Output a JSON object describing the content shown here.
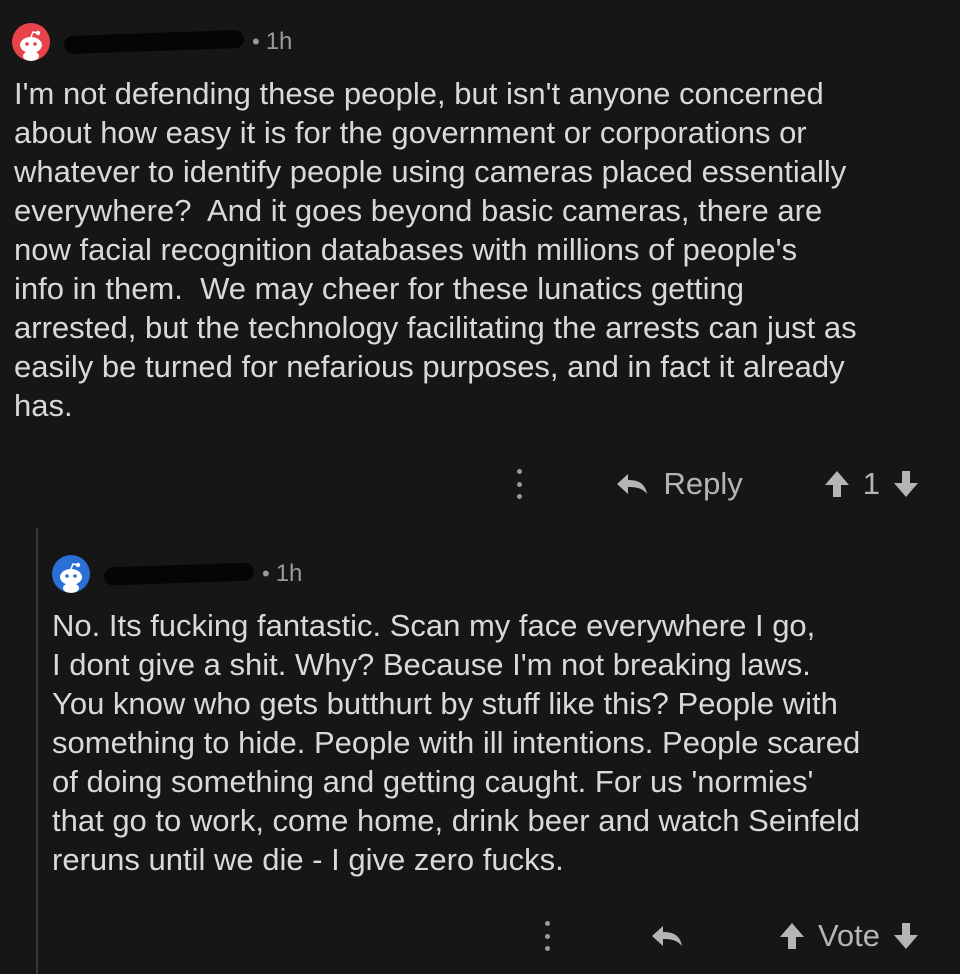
{
  "comments": [
    {
      "avatar_icon": "snoo-avatar-icon",
      "avatar_color": "#e8424a",
      "separator": "•",
      "time": "1h",
      "body": "I'm not defending these people, but isn't anyone concerned\nabout how easy it is for the government or corporations or\nwhatever to identify people using cameras placed essentially\neverywhere?  And it goes beyond basic cameras, there are\nnow facial recognition databases with millions of people's\ninfo in them.  We may cheer for these lunatics getting\narrested, but the technology facilitating the arrests can just as\neasily be turned for nefarious purposes, and in fact it already\nhas.",
      "reply_label": "Reply",
      "vote_label": "1"
    },
    {
      "avatar_icon": "snoo-avatar-icon",
      "avatar_color": "#2a6fd6",
      "separator": "•",
      "time": "1h",
      "body": "No. Its fucking fantastic. Scan my face everywhere I go,\nI dont give a shit. Why? Because I'm not breaking laws.\nYou know who gets butthurt by stuff like this? People with\nsomething to hide. People with ill intentions. People scared\nof doing something and getting caught. For us 'normies'\nthat go to work, come home, drink beer and watch Seinfeld\nreruns until we die - I give zero fucks.",
      "reply_label": "",
      "vote_label": "Vote"
    }
  ]
}
